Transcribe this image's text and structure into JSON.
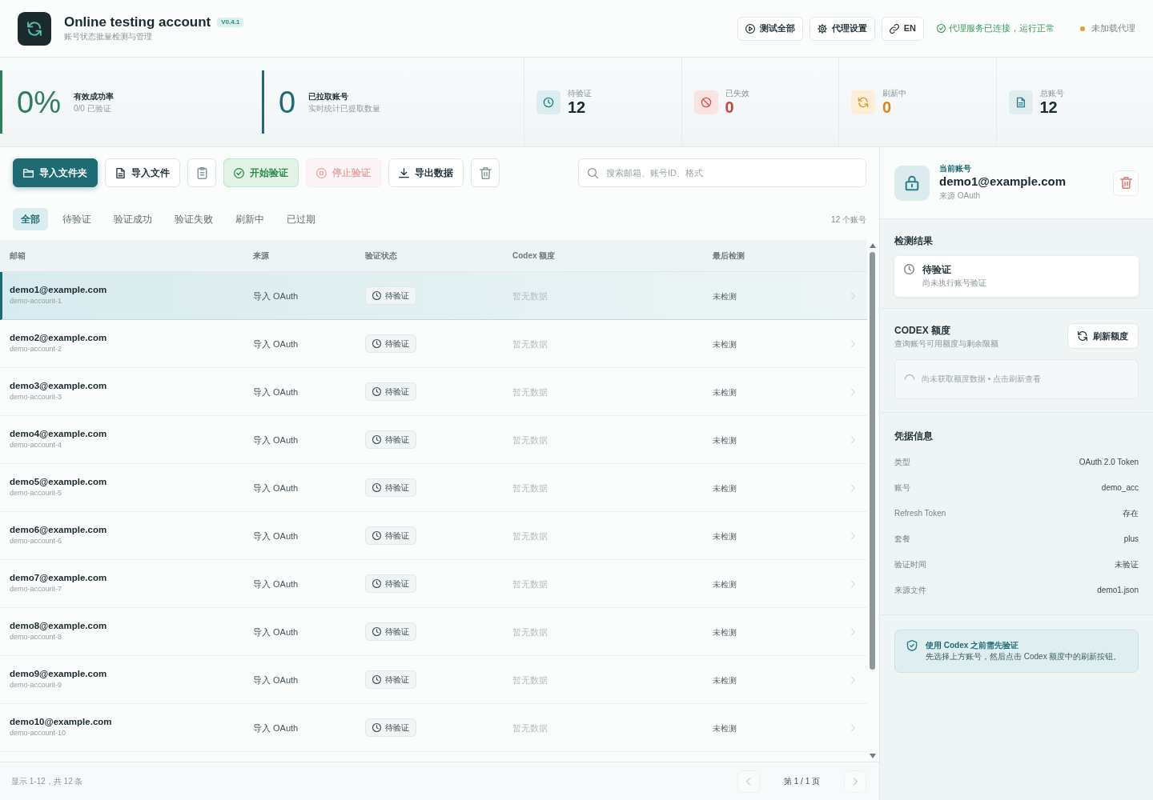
{
  "header": {
    "title": "Online testing account",
    "version": "V0.4.1",
    "subtitle": "账号状态批量检测与管理",
    "buttons": [
      {
        "label": "测试全部"
      },
      {
        "label": "代理设置"
      },
      {
        "label": "EN"
      }
    ],
    "status": {
      "text": "代理服务已连接，运行正常"
    },
    "indicator": {
      "text": "未加载代理",
      "color": "#e0a030"
    }
  },
  "summary": [
    {
      "value": "0%",
      "label": "有效成功率",
      "caption": "0/0 已验证",
      "color": "#2e7d5b"
    },
    {
      "value": "0",
      "label": "已拉取账号",
      "caption": "实时统计已提取数量",
      "color": "#1f6b74"
    }
  ],
  "stat_cards": [
    {
      "kind": "pending",
      "label": "待验证",
      "value": "12"
    },
    {
      "kind": "failed",
      "label": "已失效",
      "value": "0"
    },
    {
      "kind": "refreshing",
      "label": "刷新中",
      "value": "0"
    },
    {
      "kind": "total",
      "label": "总账号",
      "value": "12"
    }
  ],
  "toolbar": {
    "buttons": [
      {
        "kind": "primary",
        "label": "导入文件夹",
        "disabled": false
      },
      {
        "kind": "outline",
        "label": "导入文件",
        "disabled": false
      },
      {
        "kind": "icon",
        "disabled": false
      },
      {
        "kind": "success",
        "label": "开始验证",
        "disabled": false
      },
      {
        "kind": "danger",
        "label": "停止验证",
        "disabled": true
      },
      {
        "kind": "outline",
        "label": "导出数据",
        "disabled": false
      },
      {
        "kind": "icon",
        "disabled": false
      }
    ],
    "search": {
      "placeholder": "搜索邮箱、账号ID、格式"
    }
  },
  "tabs": [
    {
      "label": "全部",
      "selected": true
    },
    {
      "label": "待验证",
      "selected": false
    },
    {
      "label": "验证成功",
      "selected": false
    },
    {
      "label": "验证失败",
      "selected": false
    },
    {
      "label": "刷新中",
      "selected": false
    },
    {
      "label": "已过期",
      "selected": false
    }
  ],
  "account_count": "12 个账号",
  "table": {
    "columns": [
      "邮箱",
      "来源",
      "验证状态",
      "Codex 额度",
      "最后检测"
    ],
    "rows": [
      {
        "email": "demo1@example.com",
        "account_id": "demo-account-1",
        "source": "导入 OAuth",
        "status": "待验证",
        "quota": "暂无数据",
        "last_checked": "未检测",
        "selected": true
      },
      {
        "email": "demo2@example.com",
        "account_id": "demo-account-2",
        "source": "导入 OAuth",
        "status": "待验证",
        "quota": "暂无数据",
        "last_checked": "未检测",
        "selected": false
      },
      {
        "email": "demo3@example.com",
        "account_id": "demo-account-3",
        "source": "导入 OAuth",
        "status": "待验证",
        "quota": "暂无数据",
        "last_checked": "未检测",
        "selected": false
      },
      {
        "email": "demo4@example.com",
        "account_id": "demo-account-4",
        "source": "导入 OAuth",
        "status": "待验证",
        "quota": "暂无数据",
        "last_checked": "未检测",
        "selected": false
      },
      {
        "email": "demo5@example.com",
        "account_id": "demo-account-5",
        "source": "导入 OAuth",
        "status": "待验证",
        "quota": "暂无数据",
        "last_checked": "未检测",
        "selected": false
      },
      {
        "email": "demo6@example.com",
        "account_id": "demo-account-6",
        "source": "导入 OAuth",
        "status": "待验证",
        "quota": "暂无数据",
        "last_checked": "未检测",
        "selected": false
      },
      {
        "email": "demo7@example.com",
        "account_id": "demo-account-7",
        "source": "导入 OAuth",
        "status": "待验证",
        "quota": "暂无数据",
        "last_checked": "未检测",
        "selected": false
      },
      {
        "email": "demo8@example.com",
        "account_id": "demo-account-8",
        "source": "导入 OAuth",
        "status": "待验证",
        "quota": "暂无数据",
        "last_checked": "未检测",
        "selected": false
      },
      {
        "email": "demo9@example.com",
        "account_id": "demo-account-9",
        "source": "导入 OAuth",
        "status": "待验证",
        "quota": "暂无数据",
        "last_checked": "未检测",
        "selected": false
      },
      {
        "email": "demo10@example.com",
        "account_id": "demo-account-10",
        "source": "导入 OAuth",
        "status": "待验证",
        "quota": "暂无数据",
        "last_checked": "未检测",
        "selected": false
      }
    ]
  },
  "footer": {
    "summary": "显示 1-12，共 12 条",
    "page": "第 1 / 1 页",
    "prev": {
      "disabled": true
    },
    "next": {
      "disabled": true
    }
  },
  "detail": {
    "eyebrow": "当前账号",
    "email": "demo1@example.com",
    "source": "来源 OAuth",
    "check": {
      "title": "检测结果",
      "status": "待验证",
      "note": "尚未执行账号验证"
    },
    "quota": {
      "title": "CODEX 额度",
      "subtitle": "查询账号可用额度与剩余限额",
      "button": "刷新额度",
      "empty": "尚未获取额度数据 • 点击刷新查看"
    },
    "credentials": {
      "title": "凭据信息",
      "rows": [
        {
          "label": "类型",
          "value": "OAuth 2.0 Token"
        },
        {
          "label": "账号",
          "value": "demo_acc"
        },
        {
          "label": "Refresh Token",
          "value": "存在"
        },
        {
          "label": "套餐",
          "value": "plus"
        },
        {
          "label": "验证时间",
          "value": "未验证"
        },
        {
          "label": "来源文件",
          "value": "demo1.json"
        }
      ]
    },
    "notice": {
      "title": "使用 Codex 之前需先验证",
      "text": "先选择上方账号，然后点击 Codex 额度中的刷新按钮。"
    }
  }
}
